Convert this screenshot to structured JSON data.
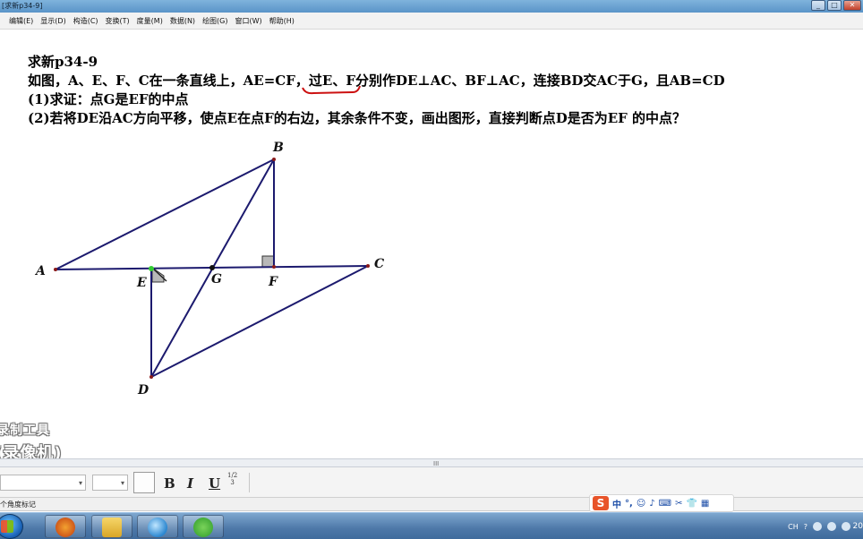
{
  "window": {
    "title": "[求新p34-9]",
    "buttons": {
      "minimize": "_",
      "maximize": "□",
      "close": "✕"
    }
  },
  "menu": [
    "编辑(E)",
    "显示(D)",
    "构造(C)",
    "变换(T)",
    "度量(M)",
    "数据(N)",
    "绘图(G)",
    "窗口(W)",
    "帮助(H)"
  ],
  "problem": {
    "title": "求新p34-9",
    "line1": "如图，A、E、F、C在一条直线上，AE=CF，过E、F分别作DE⊥AC、BF⊥AC，连接BD交AC于G，且AB=CD",
    "line2": "(1)求证：点G是EF的中点",
    "line3": "(2)若将DE沿AC方向平移，使点E在点F的右边，其余条件不变，画出图形，直接判断点D是否为EF 的中点？",
    "underlined_segment": "AE=CF"
  },
  "diagram": {
    "point_labels": {
      "A": "A",
      "B": "B",
      "C": "C",
      "D": "D",
      "E": "E",
      "F": "F",
      "G": "G"
    },
    "colors": {
      "segment": "#1c1a6e",
      "highlight": "#cc1111",
      "right_angle_fill": "#b8b8b8",
      "point": "#8a1a1a",
      "selected_point": "#33cc33"
    }
  },
  "watermark": {
    "line1": "录制工具",
    "line2": "(录像机)"
  },
  "splitter": {
    "grip": "III"
  },
  "text_toolbar": {
    "font_value": "",
    "size_value": "",
    "bold": "B",
    "italic": "I",
    "underline": "U",
    "math_label_top": "1/2",
    "math_label_bottom": "3"
  },
  "status": {
    "text": "个角度标记"
  },
  "ime": {
    "logo": "S",
    "mode": "中",
    "punct": "°,",
    "items": [
      "☺",
      "♪",
      "⌨",
      "✂",
      "👕",
      "▦"
    ]
  },
  "tray": {
    "lang": "CH",
    "help": "?",
    "clock": "20"
  }
}
